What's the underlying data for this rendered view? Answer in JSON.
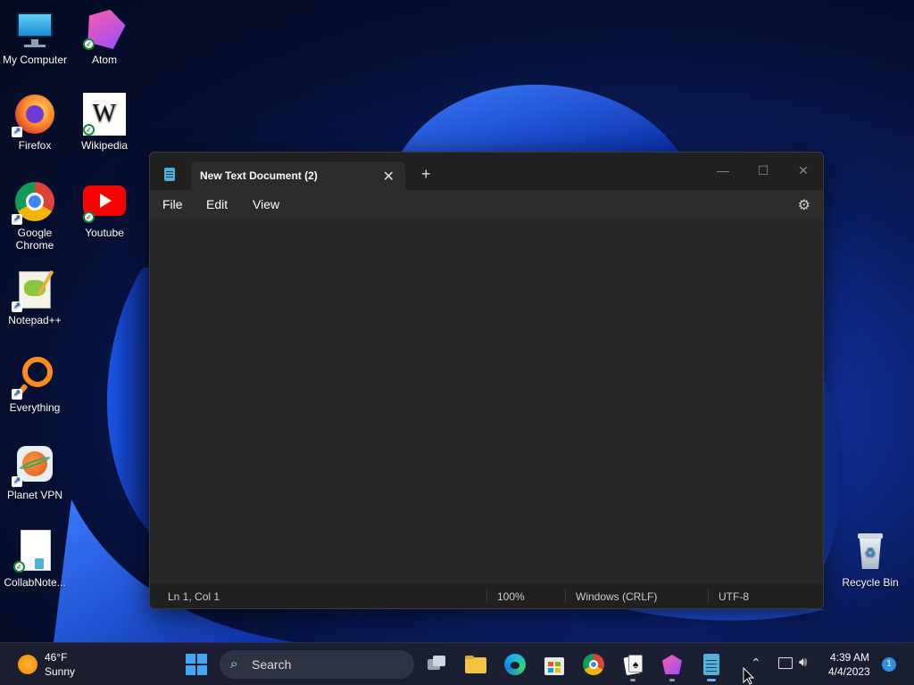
{
  "desktop": {
    "icons": [
      {
        "label": "My Computer"
      },
      {
        "label": "Atom"
      },
      {
        "label": "Firefox"
      },
      {
        "label": "Wikipedia"
      },
      {
        "label": "Google Chrome"
      },
      {
        "label": "Youtube"
      },
      {
        "label": "Notepad++"
      },
      {
        "label": "Everything"
      },
      {
        "label": "Planet VPN"
      },
      {
        "label": "CollabNote..."
      },
      {
        "label": "Recycle Bin"
      }
    ]
  },
  "notepad": {
    "tab_title": "New Text Document (2)",
    "close_tab": "✕",
    "new_tab": "+",
    "minimize": "—",
    "maximize": "☐",
    "close": "✕",
    "menu": {
      "file": "File",
      "edit": "Edit",
      "view": "View"
    },
    "content": "",
    "status": {
      "position": "Ln 1, Col 1",
      "zoom": "100%",
      "line_ending": "Windows (CRLF)",
      "encoding": "UTF-8"
    }
  },
  "taskbar": {
    "weather": {
      "temp": "46°F",
      "condition": "Sunny"
    },
    "search_label": "Search",
    "clock": {
      "time": "4:39 AM",
      "date": "4/4/2023"
    },
    "notification_count": "1"
  },
  "colors": {
    "accent": "#0078d4",
    "window_bg": "#272727",
    "titlebar_bg": "#202020"
  }
}
